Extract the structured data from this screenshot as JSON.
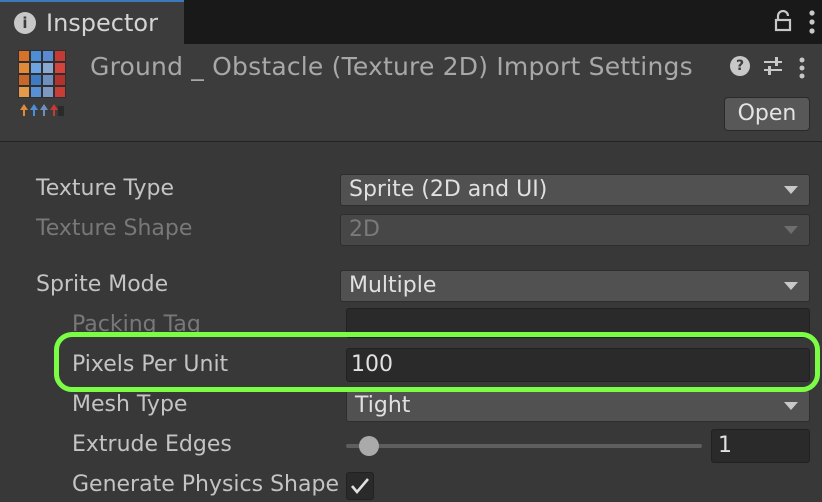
{
  "tab": {
    "title": "Inspector"
  },
  "header": {
    "title": "Ground _ Obstacle (Texture 2D) Import Settings",
    "open_button": "Open"
  },
  "settings": {
    "texture_type": {
      "label": "Texture Type",
      "value": "Sprite (2D and UI)"
    },
    "texture_shape": {
      "label": "Texture Shape",
      "value": "2D"
    },
    "sprite_mode": {
      "label": "Sprite Mode",
      "value": "Multiple"
    },
    "packing_tag": {
      "label": "Packing Tag",
      "value": ""
    },
    "pixels_per_unit": {
      "label": "Pixels Per Unit",
      "value": "100"
    },
    "mesh_type": {
      "label": "Mesh Type",
      "value": "Tight"
    },
    "extrude_edges": {
      "label": "Extrude Edges",
      "value": "1",
      "slider_fraction": 0.01
    },
    "generate_physics_shape": {
      "label": "Generate Physics Shape",
      "checked": true
    }
  },
  "colors": {
    "highlight": "#7cfd45",
    "tab_accent": "#3a79bb"
  }
}
